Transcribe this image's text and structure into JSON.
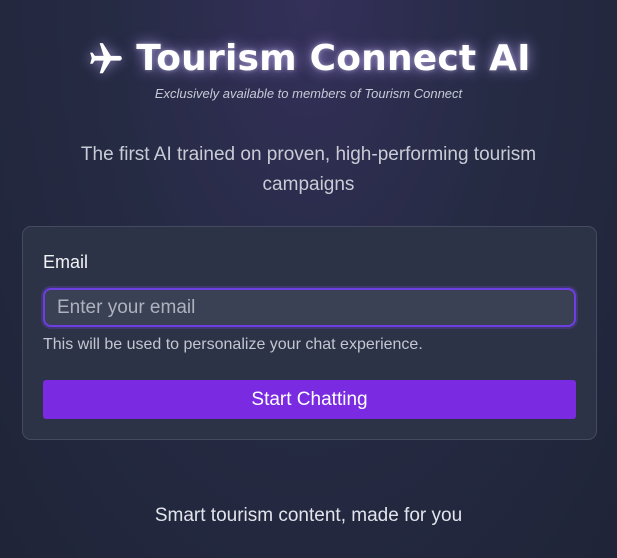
{
  "header": {
    "icon": "airplane-icon",
    "title": "Tourism Connect AI",
    "subtitle": "Exclusively available to members of Tourism Connect"
  },
  "tagline": "The first AI trained on proven, high-performing tourism campaigns",
  "form": {
    "email_label": "Email",
    "email_value": "",
    "email_placeholder": "Enter your email",
    "helper_text": "This will be used to personalize your chat experience.",
    "submit_label": "Start Chatting"
  },
  "footer": {
    "text": "Smart tourism content, made for you"
  },
  "colors": {
    "accent": "#7a2be2",
    "background": "#262b44",
    "card": "#2d3346"
  }
}
